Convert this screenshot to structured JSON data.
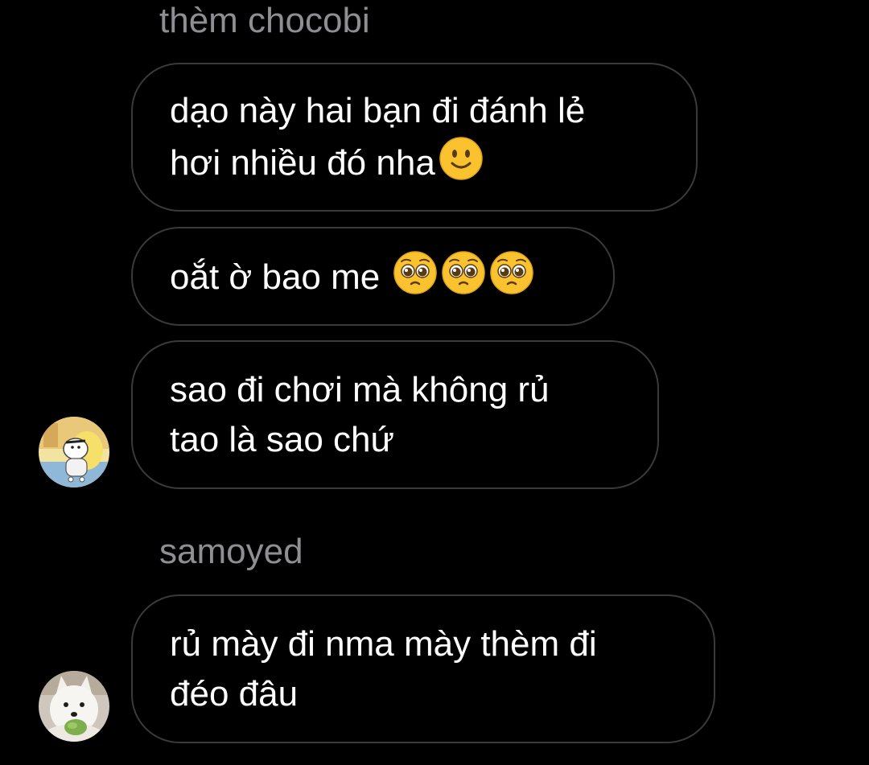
{
  "thread": {
    "groups": [
      {
        "sender": "thèm chocobi",
        "messages": [
          {
            "text": "dạo này hai bạn đi đánh lẻ\nhơi nhiều đó nha",
            "emoji": [
              "slightly-smiling-face-emoji"
            ]
          },
          {
            "text": "oắt ờ bao me",
            "emoji": [
              "pleading-face-emoji",
              "pleading-face-emoji",
              "pleading-face-emoji"
            ]
          },
          {
            "text": "sao đi chơi mà không rủ\ntao là sao chứ",
            "emoji": []
          }
        ],
        "avatar": "cartoon-avatar"
      },
      {
        "sender": "samoyed",
        "messages": [
          {
            "text": "rủ mày đi nma mày thèm đi\nđéo đâu",
            "emoji": []
          }
        ],
        "avatar": "samoyed-dog-avatar"
      }
    ]
  },
  "colors": {
    "background": "#000000",
    "bubble_border": "#3a3a3c",
    "sender_text": "#8e8e93",
    "message_text": "#ffffff",
    "emoji_yellow": "#f9c22e"
  }
}
